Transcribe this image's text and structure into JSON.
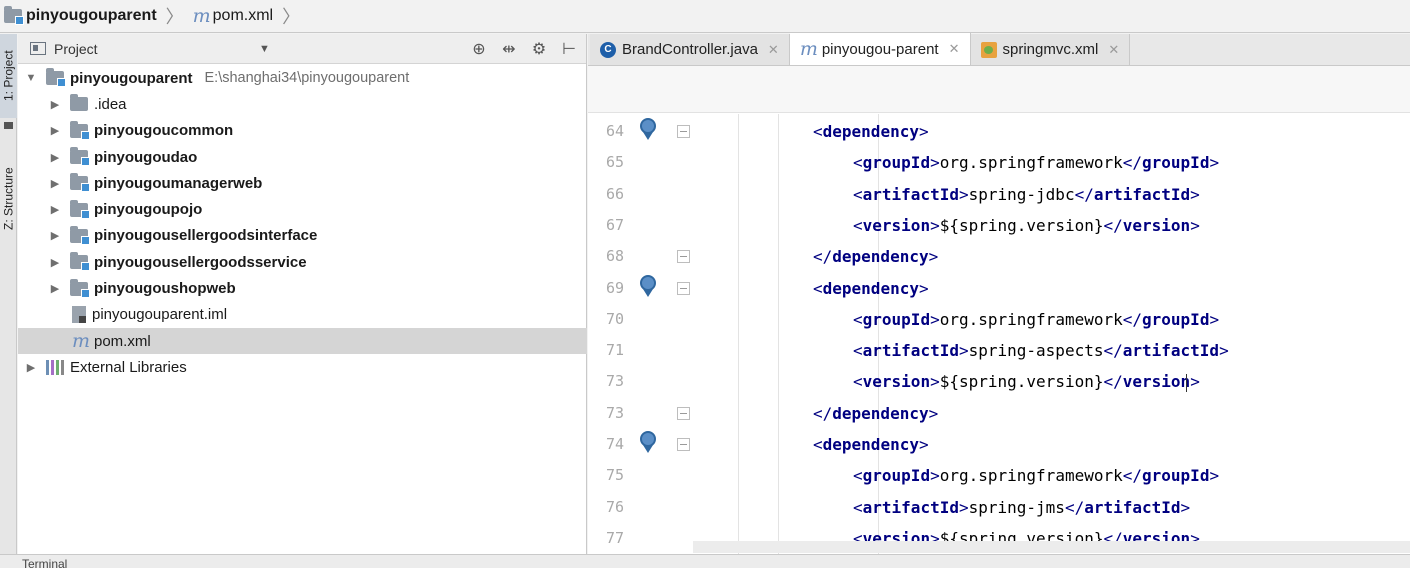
{
  "navbar": {
    "project": "pinyougouparent",
    "file": "pom.xml"
  },
  "strip": {
    "project_tab": "1: Project",
    "structure_tab": "Z: Structure"
  },
  "project_panel": {
    "title": "Project",
    "tree": [
      {
        "label": "pinyougouparent",
        "path": "E:\\shanghai34\\pinyougouparent",
        "bold": true,
        "expanded": true,
        "depth": 0,
        "icon": "module-folder-icon"
      },
      {
        "label": ".idea",
        "bold": false,
        "depth": 1,
        "icon": "folder-icon",
        "arrow": true
      },
      {
        "label": "pinyougoucommon",
        "bold": true,
        "depth": 1,
        "icon": "module-folder-icon",
        "arrow": true
      },
      {
        "label": "pinyougoudao",
        "bold": true,
        "depth": 1,
        "icon": "module-folder-icon",
        "arrow": true
      },
      {
        "label": "pinyougoumanagerweb",
        "bold": true,
        "depth": 1,
        "icon": "module-folder-icon",
        "arrow": true
      },
      {
        "label": "pinyougoupojo",
        "bold": true,
        "depth": 1,
        "icon": "module-folder-icon",
        "arrow": true
      },
      {
        "label": "pinyougousellergoodsinterface",
        "bold": true,
        "depth": 1,
        "icon": "module-folder-icon",
        "arrow": true
      },
      {
        "label": "pinyougousellergoodsservice",
        "bold": true,
        "depth": 1,
        "icon": "module-folder-icon",
        "arrow": true
      },
      {
        "label": "pinyougoushopweb",
        "bold": true,
        "depth": 1,
        "icon": "module-folder-icon",
        "arrow": true
      },
      {
        "label": "pinyougouparent.iml",
        "bold": false,
        "depth": 1,
        "icon": "iml-file-icon",
        "arrow": false
      },
      {
        "label": "pom.xml",
        "bold": false,
        "depth": 1,
        "icon": "maven-icon",
        "arrow": false,
        "selected": true
      },
      {
        "label": "External Libraries",
        "bold": false,
        "depth": 0,
        "icon": "libraries-icon",
        "arrow": true
      }
    ]
  },
  "editor": {
    "tabs": [
      {
        "label": "BrandController.java",
        "icon": "java-class-icon",
        "active": false
      },
      {
        "label": "pinyougou-parent",
        "icon": "maven-icon",
        "active": true
      },
      {
        "label": "springmvc.xml",
        "icon": "xml-file-icon",
        "active": false
      }
    ],
    "lines": [
      {
        "num": "64",
        "indent": 1,
        "parts": [
          [
            "bk",
            "<"
          ],
          [
            "tg",
            "dependency"
          ],
          [
            "bk",
            ">"
          ]
        ],
        "maven": true,
        "fold": true
      },
      {
        "num": "65",
        "indent": 2,
        "parts": [
          [
            "bk",
            "<"
          ],
          [
            "tg",
            "groupId"
          ],
          [
            "bk",
            ">"
          ],
          [
            "tx",
            "org.springframework"
          ],
          [
            "bk",
            "</"
          ],
          [
            "tg",
            "groupId"
          ],
          [
            "bk",
            ">"
          ]
        ]
      },
      {
        "num": "66",
        "indent": 2,
        "parts": [
          [
            "bk",
            "<"
          ],
          [
            "tg",
            "artifactId"
          ],
          [
            "bk",
            ">"
          ],
          [
            "tx",
            "spring-jdbc"
          ],
          [
            "bk",
            "</"
          ],
          [
            "tg",
            "artifactId"
          ],
          [
            "bk",
            ">"
          ]
        ]
      },
      {
        "num": "67",
        "indent": 2,
        "parts": [
          [
            "bk",
            "<"
          ],
          [
            "tg",
            "version"
          ],
          [
            "bk",
            ">"
          ],
          [
            "tx",
            "${spring.version}"
          ],
          [
            "bk",
            "</"
          ],
          [
            "tg",
            "version"
          ],
          [
            "bk",
            ">"
          ]
        ]
      },
      {
        "num": "68",
        "indent": 1,
        "parts": [
          [
            "bk",
            "</"
          ],
          [
            "tg",
            "dependency"
          ],
          [
            "bk",
            ">"
          ]
        ],
        "fold": true
      },
      {
        "num": "69",
        "indent": 1,
        "parts": [
          [
            "bk",
            "<"
          ],
          [
            "tg",
            "dependency"
          ],
          [
            "bk",
            ">"
          ]
        ],
        "maven": true,
        "fold": true
      },
      {
        "num": "70",
        "indent": 2,
        "parts": [
          [
            "bk",
            "<"
          ],
          [
            "tg",
            "groupId"
          ],
          [
            "bk",
            ">"
          ],
          [
            "tx",
            "org.springframework"
          ],
          [
            "bk",
            "</"
          ],
          [
            "tg",
            "groupId"
          ],
          [
            "bk",
            ">"
          ]
        ]
      },
      {
        "num": "71",
        "indent": 2,
        "parts": [
          [
            "bk",
            "<"
          ],
          [
            "tg",
            "artifactId"
          ],
          [
            "bk",
            ">"
          ],
          [
            "tx",
            "spring-aspects"
          ],
          [
            "bk",
            "</"
          ],
          [
            "tg",
            "artifactId"
          ],
          [
            "bk",
            ">"
          ]
        ]
      },
      {
        "num": "73",
        "indent": 2,
        "parts": [
          [
            "bk",
            "<"
          ],
          [
            "tg",
            "version"
          ],
          [
            "bk",
            ">"
          ],
          [
            "tx",
            "${spring.version}"
          ],
          [
            "bk",
            "</"
          ],
          [
            "tg",
            "version"
          ],
          [
            "bk",
            ">"
          ]
        ]
      },
      {
        "num": "73",
        "indent": 1,
        "parts": [
          [
            "bk",
            "</"
          ],
          [
            "tg",
            "dependency"
          ],
          [
            "bk",
            ">"
          ]
        ],
        "fold": true
      },
      {
        "num": "74",
        "indent": 1,
        "parts": [
          [
            "bk",
            "<"
          ],
          [
            "tg",
            "dependency"
          ],
          [
            "bk",
            ">"
          ]
        ],
        "maven": true,
        "fold": true
      },
      {
        "num": "75",
        "indent": 2,
        "parts": [
          [
            "bk",
            "<"
          ],
          [
            "tg",
            "groupId"
          ],
          [
            "bk",
            ">"
          ],
          [
            "tx",
            "org.springframework"
          ],
          [
            "bk",
            "</"
          ],
          [
            "tg",
            "groupId"
          ],
          [
            "bk",
            ">"
          ]
        ]
      },
      {
        "num": "76",
        "indent": 2,
        "parts": [
          [
            "bk",
            "<"
          ],
          [
            "tg",
            "artifactId"
          ],
          [
            "bk",
            ">"
          ],
          [
            "tx",
            "spring-jms"
          ],
          [
            "bk",
            "</"
          ],
          [
            "tg",
            "artifactId"
          ],
          [
            "bk",
            ">"
          ]
        ]
      },
      {
        "num": "77",
        "indent": 2,
        "parts": [
          [
            "bk",
            "<"
          ],
          [
            "tg",
            "version"
          ],
          [
            "bk",
            ">"
          ],
          [
            "tx",
            "${spring.version}"
          ],
          [
            "bk",
            "</"
          ],
          [
            "tg",
            "version"
          ],
          [
            "bk",
            ">"
          ]
        ]
      }
    ]
  },
  "bottom": {
    "terminal_label": "Terminal"
  }
}
